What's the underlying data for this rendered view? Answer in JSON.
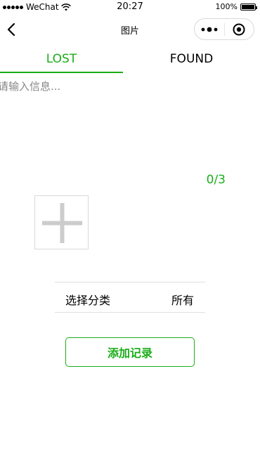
{
  "status_bar": {
    "carrier": "WeChat",
    "time": "20:27",
    "battery": "100%",
    "battery_level": 1.0
  },
  "nav": {
    "title": "图片",
    "icons": [
      "back-chevron-icon",
      "more-dots-icon",
      "close-circle-icon"
    ]
  },
  "tabs": [
    {
      "label": "LOST",
      "active": true
    },
    {
      "label": "FOUND",
      "active": false
    }
  ],
  "form": {
    "info_placeholder": "请输入信息...",
    "info_value": "",
    "image_count": "0/3",
    "upload_icon": "plus-icon",
    "category_label": "选择分类",
    "category_value": "所有",
    "submit_label": "添加记录"
  },
  "colors": {
    "accent": "#1aad19",
    "border": "#d9d9d9",
    "placeholder": "#888888"
  }
}
